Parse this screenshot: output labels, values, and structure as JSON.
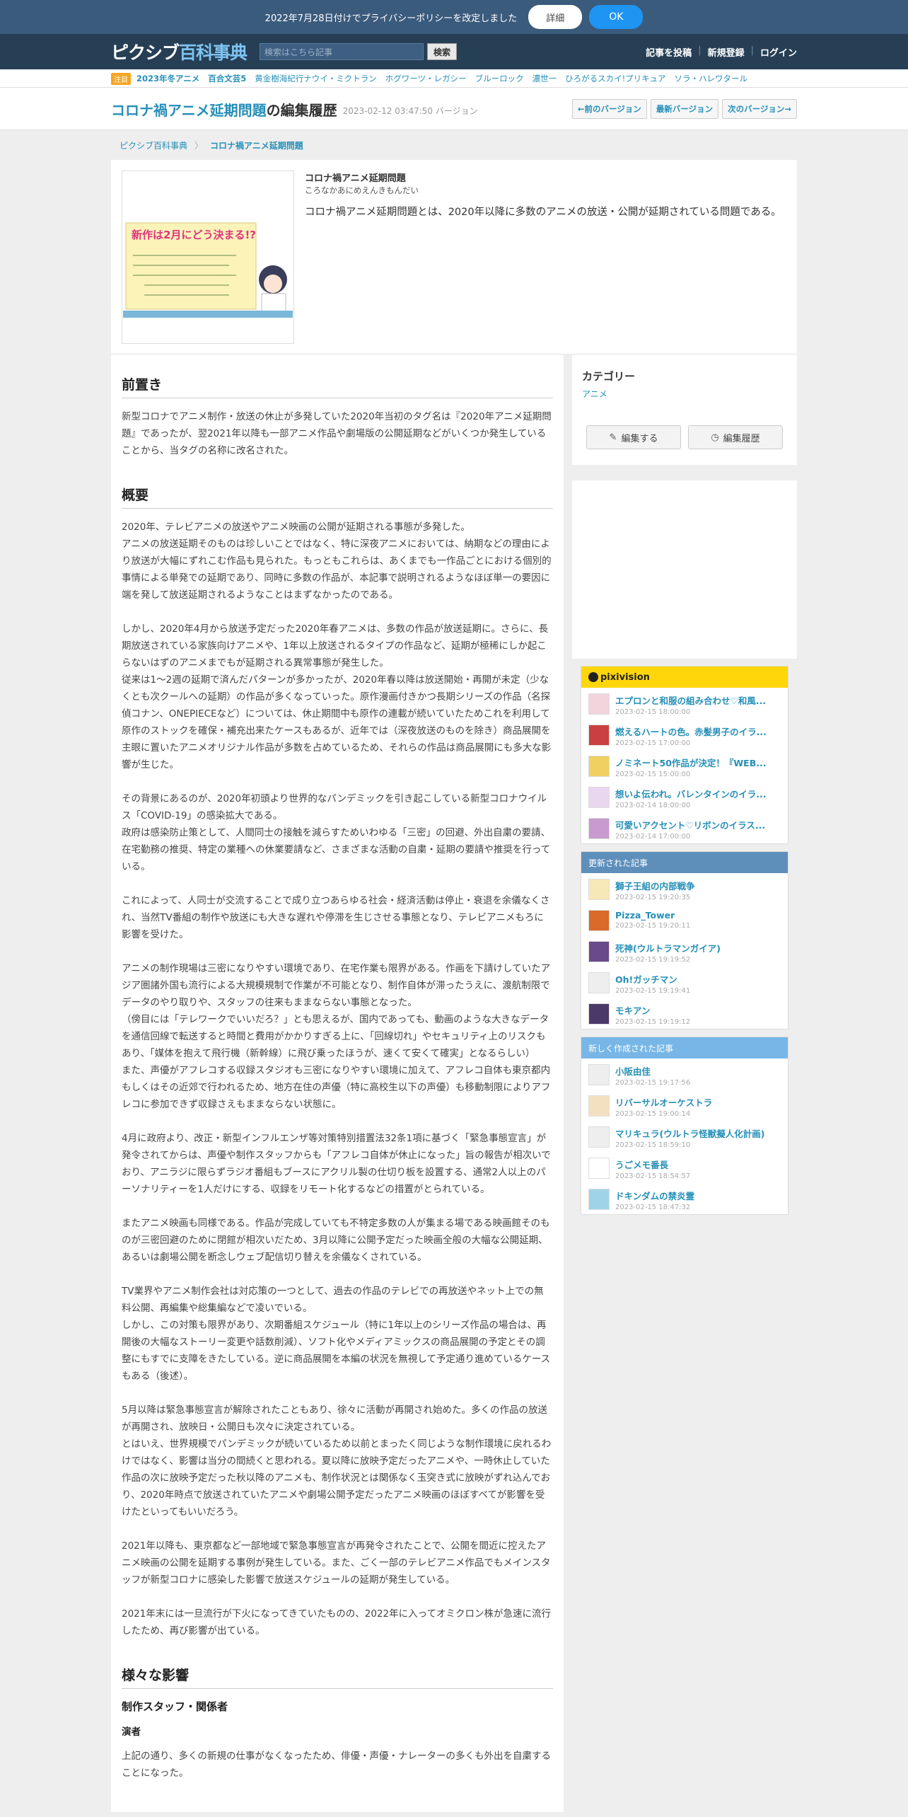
{
  "notice": {
    "text": "2022年7月28日付けでプライバシーポリシーを改定しました",
    "detail": "詳細",
    "ok": "OK"
  },
  "header": {
    "logo_a": "ピクシブ",
    "logo_b": "百科事典",
    "search_placeholder": "検索はこちら記事",
    "search_button": "検索",
    "nav": [
      "記事を投稿",
      "新規登録",
      "ログイン"
    ]
  },
  "trending": {
    "badge": "注目",
    "items": [
      "2023年冬アニメ",
      "百合文芸5",
      "黄金樹海紀行ナウイ・ミクトラン",
      "ホグワーツ・レガシー",
      "ブルーロック",
      "濃世一",
      "ひろがるスカイ!プリキュア",
      "ソラ・ハレワタール"
    ]
  },
  "title": {
    "main": "コロナ禍アニメ延期問題",
    "suffix": "の編集履歴",
    "version": "2023-02-12 03:47:50 バージョン",
    "buttons": [
      "←前のバージョン",
      "最新バージョン",
      "次のバージョン→"
    ]
  },
  "breadcrumb": [
    "ピクシブ百科事典",
    "コロナ禍アニメ延期問題"
  ],
  "card": {
    "title": "コロナ禍アニメ延期問題",
    "reading": "ころなかあにめえんきもんだい",
    "desc": "コロナ禍アニメ延期問題とは、2020年以降に多数のアニメの放送・公開が延期されている問題である。",
    "thumb_text": "新作は2月にどう決まる!?"
  },
  "content": {
    "h_preface": "前置き",
    "p_preface": "新型コロナでアニメ制作・放送の休止が多発していた2020年当初のタグ名は『2020年アニメ延期問題』であったが、翌2021年以降も一部アニメ作品や劇場版の公開延期などがいくつか発生していることから、当タグの名称に改名された。",
    "h_overview": "概要",
    "p1": "2020年、テレビアニメの放送やアニメ映画の公開が延期される事態が多発した。",
    "p2": "アニメの放送延期そのものは珍しいことではなく、特に深夜アニメにおいては、納期などの理由により放送が大幅にずれこむ作品も見られた。もっともこれらは、あくまでも一作品ごとにおける個別的事情による単発での延期であり、同時に多数の作品が、本記事で説明されるようなほぼ単一の要因に端を発して放送延期されるようなことはまずなかったのである。",
    "p3": "しかし、2020年4月から放送予定だった2020年春アニメは、多数の作品が放送延期に。さらに、長期放送されている家族向けアニメや、1年以上放送されるタイプの作品など、延期が極稀にしか起こらないはずのアニメまでもが延期される異常事態が発生した。",
    "p4": "従来は1～2週の延期で済んだパターンが多かったが、2020年春以降は放送開始・再開が未定（少なくとも次クールへの延期）の作品が多くなっていった。原作漫画付きかつ長期シリーズの作品（名探偵コナン、ONEPIECEなど）については、休止期間中も原作の連載が続いていたためこれを利用して原作のストックを確保・補充出来たケースもあるが、近年では（深夜放送のものを除き）商品展開を主眼に置いたアニメオリジナル作品が多数を占めているため、それらの作品は商品展開にも多大な影響が生じた。",
    "p5": "その背景にあるのが、2020年初頭より世界的なパンデミックを引き起こしている新型コロナウイルス「COVID-19」の感染拡大である。",
    "p6": "政府は感染防止策として、人間同士の接触を減らすためいわゆる「三密」の回避、外出自粛の要請、在宅勤務の推奨、特定の業種への休業要請など、さまざまな活動の自粛・延期の要請や推奨を行っている。",
    "p7": "これによって、人同士が交流することで成り立つあらゆる社会・経済活動は停止・衰退を余儀なくされ、当然TV番組の制作や放送にも大きな遅れや停滞を生じさせる事態となり、テレビアニメもろに影響を受けた。",
    "p8": "アニメの制作現場は三密になりやすい環境であり、在宅作業も限界がある。作画を下請けしていたアジア圏諸外国も流行による大規模規制で作業が不可能となり、制作自体が滞ったうえに、渡航制限でデータのやり取りや、スタッフの往来もままならない事態となった。",
    "p9": "（傍目には「テレワークでいいだろ？」とも思えるが、国内であっても、動画のような大きなデータを通信回線で転送すると時間と費用がかかりすぎる上に、「回線切れ」やセキュリティ上のリスクもあり、「媒体を抱えて飛行機（新幹線）に飛び乗ったほうが、速くて安くて確実」となるらしい）",
    "p10": "また、声優がアフレコする収録スタジオも三密になりやすい環境に加えて、アフレコ自体も東京都内もしくはその近郊で行われるため、地方在住の声優（特に高校生以下の声優）も移動制限によりアフレコに参加できず収録さえもままならない状態に。",
    "p11": "4月に政府より、改正・新型インフルエンザ等対策特別措置法32条1項に基づく「緊急事態宣言」が発令されてからは、声優や制作スタッフからも「アフレコ自体が休止になった」旨の報告が相次いでおり、アニラジに限らずラジオ番組もブースにアクリル製の仕切り板を設置する、通常2人以上のパーソナリティーを1人だけにする、収録をリモート化するなどの措置がとられている。",
    "p12": "またアニメ映画も同様である。作品が完成していても不特定多数の人が集まる場である映画館そのものが三密回避のために閉館が相次いだため、3月以降に公開予定だった映画全般の大幅な公開延期、あるいは劇場公開を断念しウェブ配信切り替えを余儀なくされている。",
    "p13": "TV業界やアニメ制作会社は対応策の一つとして、過去の作品のテレビでの再放送やネット上での無料公開、再編集や総集編などで凌いでいる。",
    "p14": "しかし、この対策も限界があり、次期番組スケジュール（特に1年以上のシリーズ作品の場合は、再開後の大幅なストーリー変更や話数削減）、ソフト化やメディアミックスの商品展開の予定とその調整にもすでに支障をきたしている。逆に商品展開を本編の状況を無視して予定通り進めているケースもある（後述）。",
    "p15": "5月以降は緊急事態宣言が解除されたこともあり、徐々に活動が再開され始めた。多くの作品の放送が再開され、放映日・公開日も次々に決定されている。",
    "p16": "とはいえ、世界規模でパンデミックが続いているため以前とまったく同じような制作環境に戻れるわけではなく、影響は当分の間続くと思われる。夏以降に放映予定だったアニメや、一時休止していた作品の次に放映予定だった秋以降のアニメも、制作状況とは関係なく玉突き式に放映がずれ込んでおり、2020年時点で放送されていたアニメや劇場公開予定だったアニメ映画のほぼすべてが影響を受けたといってもいいだろう。",
    "p17": "2021年以降も、東京都など一部地域で緊急事態宣言が再発令されたことで、公開を間近に控えたアニメ映画の公開を延期する事例が発生している。また、ごく一部のテレビアニメ作品でもメインスタッフが新型コロナに感染した影響で放送スケジュールの延期が発生している。",
    "p18": "2021年末には一旦流行が下火になってきていたものの、2022年に入ってオミクロン株が急速に流行したため、再び影響が出ている。",
    "h_effects": "様々な影響",
    "h3_staff": "制作スタッフ・関係者",
    "h4_cast": "演者",
    "p19": "上記の通り、多くの新規の仕事がなくなったため、俳優・声優・ナレーターの多くも外出を自粛することになった。"
  },
  "sidebar": {
    "category_title": "カテゴリー",
    "category_item": "アニメ",
    "edit_label": "編集する",
    "history_label": "編集履歴",
    "pixivision_title": "pixivision",
    "pixivision": [
      {
        "title": "エプロンと和服の組み合わせ♡和風...",
        "date": "2023-02-15 18:00:00",
        "color": "#f3d3dc"
      },
      {
        "title": "燃えるハートの色。赤髪男子のイラ...",
        "date": "2023-02-15 17:00:00",
        "color": "#c94040"
      },
      {
        "title": "ノミネート50作品が決定！『WEB...",
        "date": "2023-02-15 15:00:00",
        "color": "#f0d060"
      },
      {
        "title": "想いよ伝われ。バレンタインのイラ...",
        "date": "2023-02-14 18:00:00",
        "color": "#e9d6ef"
      },
      {
        "title": "可愛いアクセント♡リボンのイラス...",
        "date": "2023-02-14 17:00:00",
        "color": "#c89ad0"
      }
    ],
    "updated_title": "更新された記事",
    "updated": [
      {
        "title": "獅子王組の内部戦争",
        "date": "2023-02-15 19:20:35",
        "color": "#f7e8b8"
      },
      {
        "title": "Pizza_Tower",
        "date": "2023-02-15 19:20:11",
        "color": "#d96a2a"
      },
      {
        "title": "死神(ウルトラマンガイア)",
        "date": "2023-02-15 19:19:52",
        "color": "#6a4a8a"
      },
      {
        "title": "Oh!ガッチマン",
        "date": "2023-02-15 19:19:41",
        "color": "#eeeeee"
      },
      {
        "title": "モキアン",
        "date": "2023-02-15 19:19:12",
        "color": "#4a3a6a"
      }
    ],
    "new_title": "新しく作成された記事",
    "new_articles": [
      {
        "title": "小阪由佳",
        "date": "2023-02-15 19:17:56",
        "color": "#eeeeee"
      },
      {
        "title": "リバーサルオーケストラ",
        "date": "2023-02-15 19:00:14",
        "color": "#f3e0c0"
      },
      {
        "title": "マリキュラ(ウルトラ怪獣擬人化計画)",
        "date": "2023-02-15 18:59:10",
        "color": "#eeeeee"
      },
      {
        "title": "うごメモ番長",
        "date": "2023-02-15 18:54:57",
        "color": "#ffffff"
      },
      {
        "title": "ドキンダムの禁炎霊",
        "date": "2023-02-15 18:47:32",
        "color": "#9fd4e8"
      }
    ]
  }
}
